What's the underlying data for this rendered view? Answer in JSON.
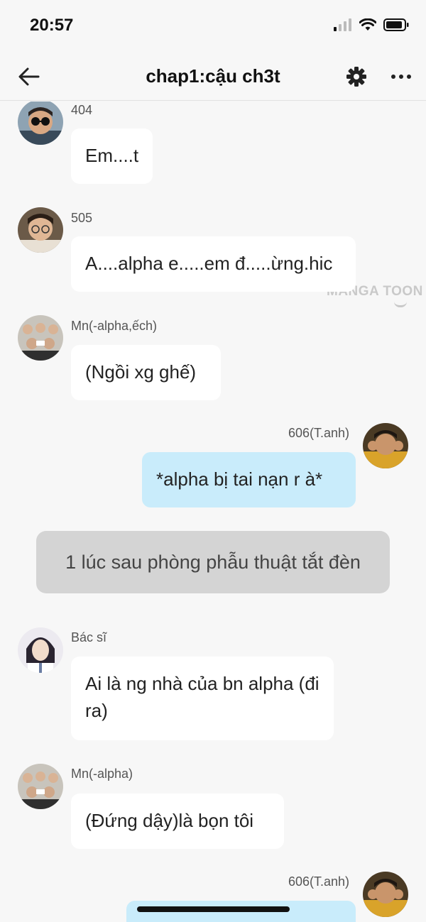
{
  "status": {
    "time": "20:57"
  },
  "nav": {
    "title": "chap1:cậu ch3t",
    "icons": [
      "back-arrow-icon",
      "gear-icon",
      "more-icon"
    ]
  },
  "watermark": "MANGA TOON",
  "messages": [
    {
      "side": "left",
      "sender": "404",
      "text": "Em....t"
    },
    {
      "side": "left",
      "sender": "505",
      "text": "A....alpha e.....em đ.....ừng.hic"
    },
    {
      "side": "left",
      "sender": "Mn(-alpha,ếch)",
      "text": "(Ngồi xg ghế)"
    },
    {
      "side": "right",
      "sender": "606(T.anh)",
      "text": "*alpha bị tai nạn r à*"
    },
    {
      "side": "narration",
      "text": "1 lúc sau phòng phẫu thuật tắt đèn"
    },
    {
      "side": "left",
      "sender": "Bác sĩ",
      "text": "Ai là ng nhà của bn alpha (đi ra)"
    },
    {
      "side": "left",
      "sender": "Mn(-alpha)",
      "text": "(Đứng dậy)là bọn tôi"
    },
    {
      "side": "right",
      "sender": "606(T.anh)",
      "text": ""
    }
  ],
  "colors": {
    "background": "#f7f7f7",
    "left_bubble": "#ffffff",
    "right_bubble": "#c9ecfb",
    "narration_bubble": "#d4d4d4"
  }
}
